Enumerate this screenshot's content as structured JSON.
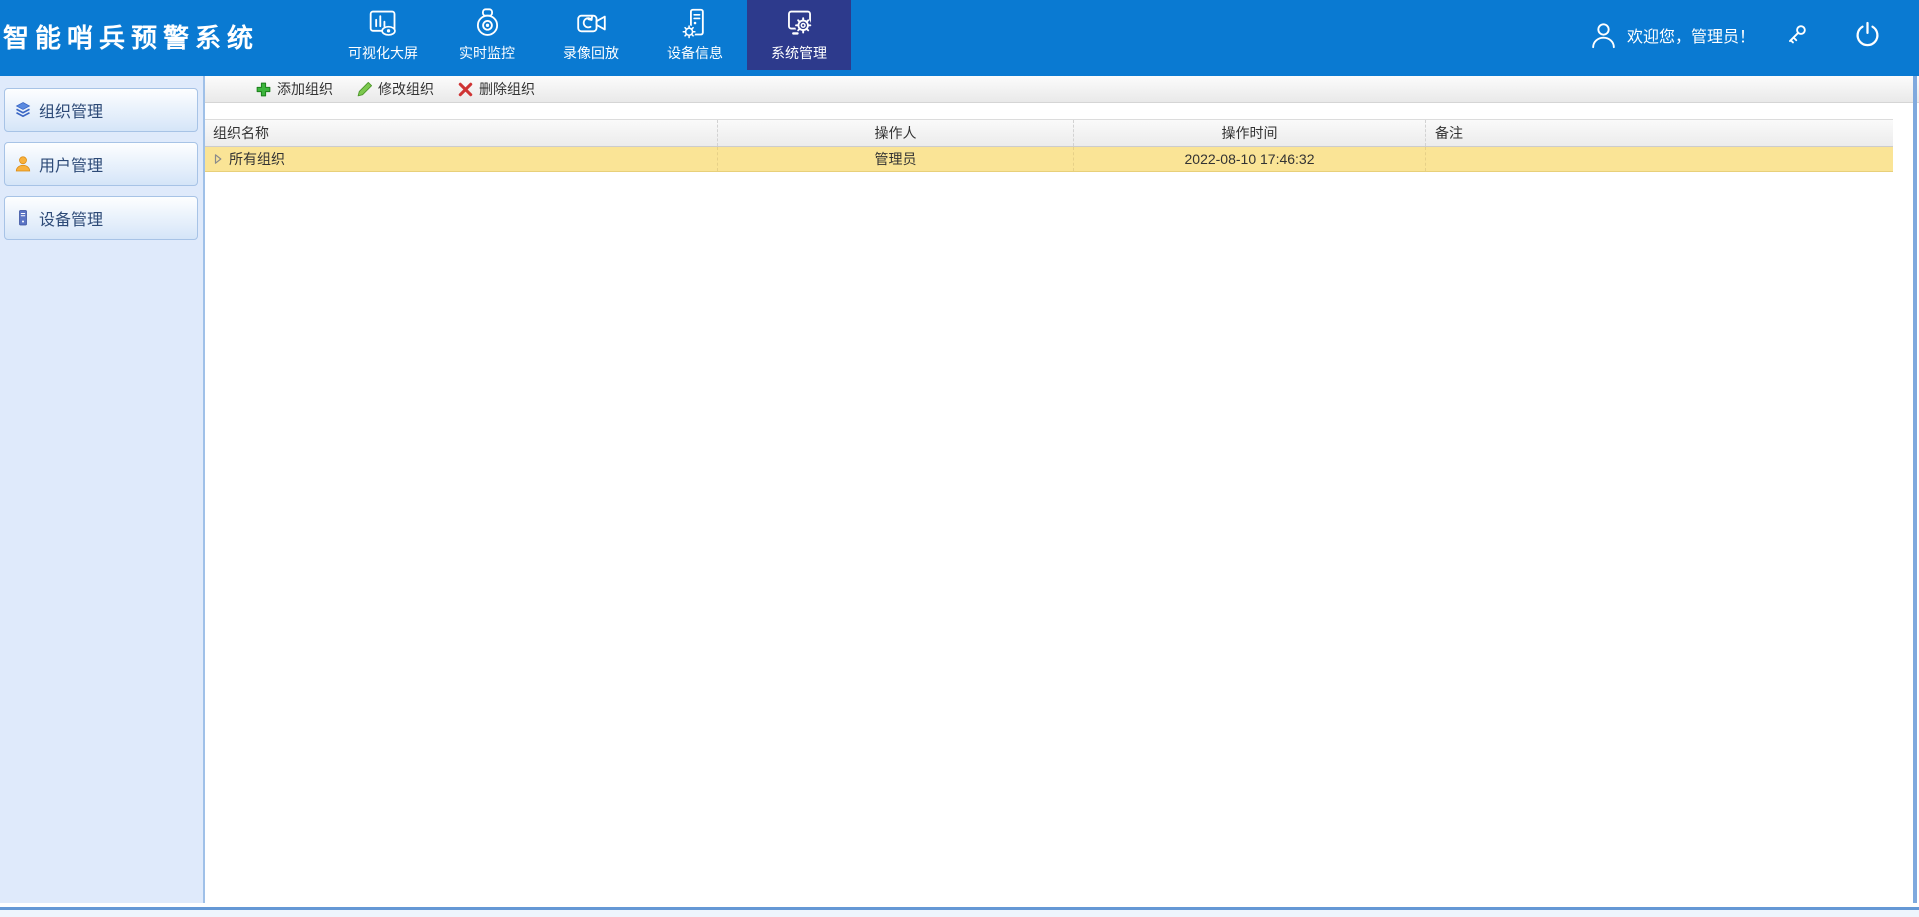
{
  "app": {
    "title": "智能哨兵预警系统"
  },
  "header": {
    "nav": [
      {
        "label": "可视化大屏",
        "icon": "dashboard-icon",
        "selected": false
      },
      {
        "label": "实时监控",
        "icon": "dome-camera-icon",
        "selected": false
      },
      {
        "label": "录像回放",
        "icon": "playback-icon",
        "selected": false
      },
      {
        "label": "设备信息",
        "icon": "device-info-icon",
        "selected": false
      },
      {
        "label": "系统管理",
        "icon": "system-settings-icon",
        "selected": true
      }
    ],
    "welcome": "欢迎您，管理员！"
  },
  "sidebar": {
    "items": [
      {
        "label": "组织管理",
        "icon": "layers-icon"
      },
      {
        "label": "用户管理",
        "icon": "user-icon"
      },
      {
        "label": "设备管理",
        "icon": "device-icon"
      }
    ]
  },
  "toolbar": {
    "buttons": [
      {
        "label": "添加组织",
        "icon": "add-plus-icon"
      },
      {
        "label": "修改组织",
        "icon": "edit-pencil-icon"
      },
      {
        "label": "删除组织",
        "icon": "delete-x-icon"
      }
    ]
  },
  "table": {
    "columns": [
      {
        "label": "组织名称",
        "align": "left"
      },
      {
        "label": "操作人",
        "align": "center"
      },
      {
        "label": "操作时间",
        "align": "center"
      },
      {
        "label": "备注",
        "align": "left"
      }
    ],
    "rows": [
      {
        "name": "所有组织",
        "operator": "管理员",
        "time": "2022-08-10 17:46:32",
        "remark": ""
      }
    ]
  },
  "colors": {
    "header_bg": "#0a7ad2",
    "tab_selected_bg": "#2d3a8c",
    "sidebar_bg": "#dfeafb",
    "sidebar_item_border": "#a7c3e6",
    "row_highlight": "#fae496",
    "footer_blue": "#6598d5",
    "add_green": "#3cb53c",
    "edit_green": "#7cc84e",
    "delete_red": "#cf3434"
  }
}
